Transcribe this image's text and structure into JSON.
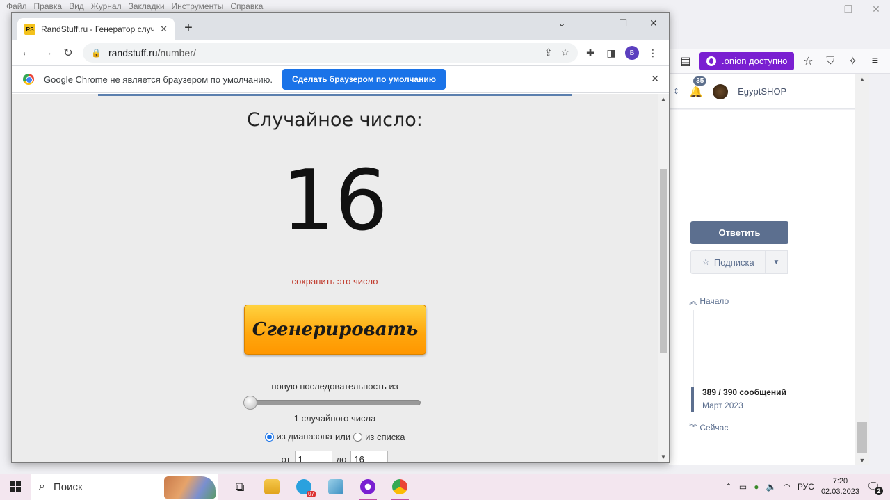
{
  "firefox": {
    "menu": [
      "Файл",
      "Правка",
      "Вид",
      "Журнал",
      "Закладки",
      "Инструменты",
      "Справка"
    ],
    "onion_label": ".onion доступно",
    "notifications_count": "35",
    "username": "EgyptSHOP",
    "reply_label": "Ответить",
    "subscribe_label": "Подписка",
    "nav_start": "Начало",
    "post_count": "389 / 390 сообщений",
    "post_date": "Март 2023",
    "nav_now": "Сейчас"
  },
  "chrome": {
    "tab_title": "RandStuff.ru - Генератор случай",
    "favicon_text": "RS",
    "url": "randstuff.ru/number/",
    "url_domain": "randstuff.ru",
    "url_path": "/number/",
    "profile_initial": "В",
    "infobar_text": "Google Chrome не является браузером по умолчанию.",
    "infobar_button": "Сделать браузером по умолчанию"
  },
  "page": {
    "title": "Случайное число:",
    "number": "16",
    "save_link": "сохранить это число",
    "generate_button": "Сгенерировать",
    "sequence_label": "новую последовательность из",
    "count_label": "1 случайного числа",
    "slider_fraction": 0.0,
    "mode_range": "из диапазона",
    "mode_or": "или",
    "mode_list": "из списка",
    "mode_range_selected": true,
    "from_label": "от",
    "from_value": "1",
    "to_label": "до",
    "to_value": "16"
  },
  "taskbar": {
    "search_placeholder": "Поиск",
    "telegram_badge": "07",
    "language": "РУС",
    "time": "7:20",
    "date": "02.03.2023",
    "notification_count": "2"
  },
  "colors": {
    "onion_accent": "#7a1fd1",
    "chrome_blue": "#1a73e8",
    "forum_accent": "#5c6f8f",
    "generate_orange": "#ffa60d"
  }
}
